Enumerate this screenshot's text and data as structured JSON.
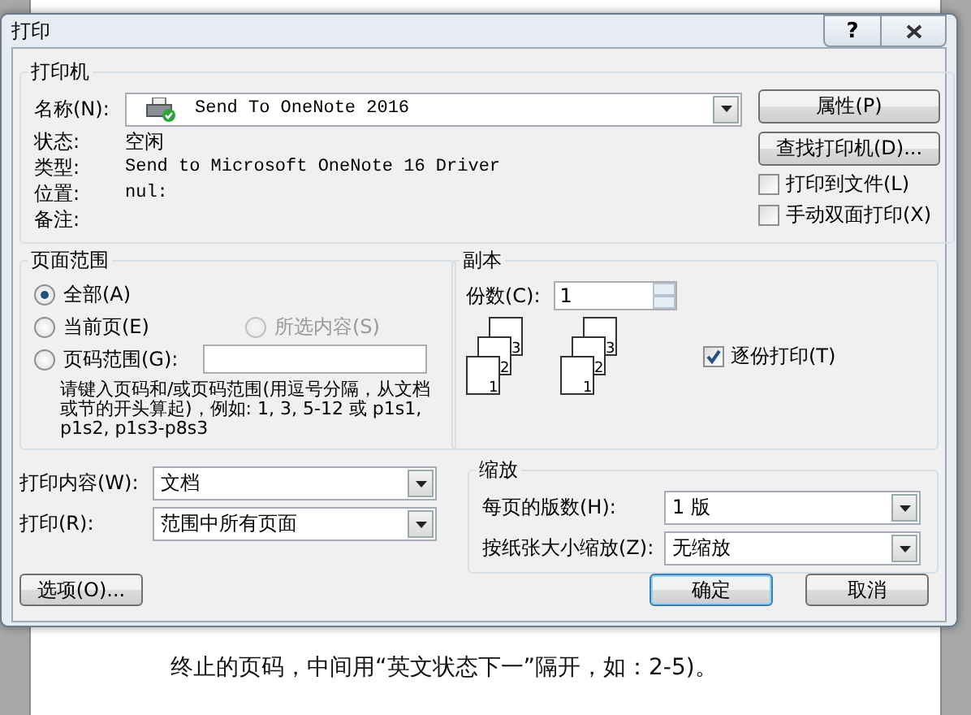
{
  "window": {
    "title": "打印",
    "help": "?"
  },
  "background_document": {
    "lines": [
      "终止的页码，中间用“英文状态下一”隔开，如：2-5)。"
    ]
  },
  "printer": {
    "title": "打印机",
    "name_label": "名称(N):",
    "name_value": "Send To OneNote 2016",
    "fields": [
      {
        "label": "状态:",
        "value": "空闲"
      },
      {
        "label": "类型:",
        "value": "Send to Microsoft OneNote 16 Driver"
      },
      {
        "label": "位置:",
        "value": "nul:"
      },
      {
        "label": "备注:"
      }
    ],
    "buttons": [
      "属性(P)",
      "查找打印机(D)..."
    ],
    "checkboxes": [
      {
        "label": "打印到文件(L)",
        "checked": false
      },
      {
        "label": "手动双面打印(X)",
        "checked": false
      }
    ]
  },
  "page_range": {
    "title": "页面范围",
    "options": [
      {
        "label": "全部(A)",
        "selected": true,
        "disabled": false
      },
      {
        "label": "当前页(E)",
        "selected": false,
        "disabled": false
      },
      {
        "label": "所选内容(S)",
        "selected": false,
        "disabled": true
      },
      {
        "label": "页码范围(G):",
        "selected": false,
        "disabled": false
      }
    ],
    "hint": "请键入页码和/或页码范围(用逗号分隔，从文档或节的开头算起)，例如: 1, 3, 5-12 或 p1s1, p1s2, p1s3-p8s3"
  },
  "copies": {
    "title": "副本",
    "count_label": "份数(C):",
    "count_value": "1",
    "stacks": [
      [
        "3",
        "2",
        "1"
      ],
      [
        "3",
        "2",
        "1"
      ]
    ],
    "collate": {
      "label": "逐份打印(T)",
      "checked": true
    }
  },
  "print_options": [
    {
      "label": "打印内容(W):",
      "value": "文档"
    },
    {
      "label": "打印(R):",
      "value": "范围中所有页面"
    }
  ],
  "zoom": {
    "title": "缩放",
    "rows": [
      {
        "label": "每页的版数(H):",
        "value": "1 版"
      },
      {
        "label": "按纸张大小缩放(Z):",
        "value": "无缩放"
      }
    ]
  },
  "footer": {
    "left_buttons": [
      {
        "label": "选项(O)...",
        "default": false
      }
    ],
    "right_buttons": [
      {
        "label": "确定",
        "default": true
      },
      {
        "label": "取消",
        "default": false
      }
    ]
  }
}
